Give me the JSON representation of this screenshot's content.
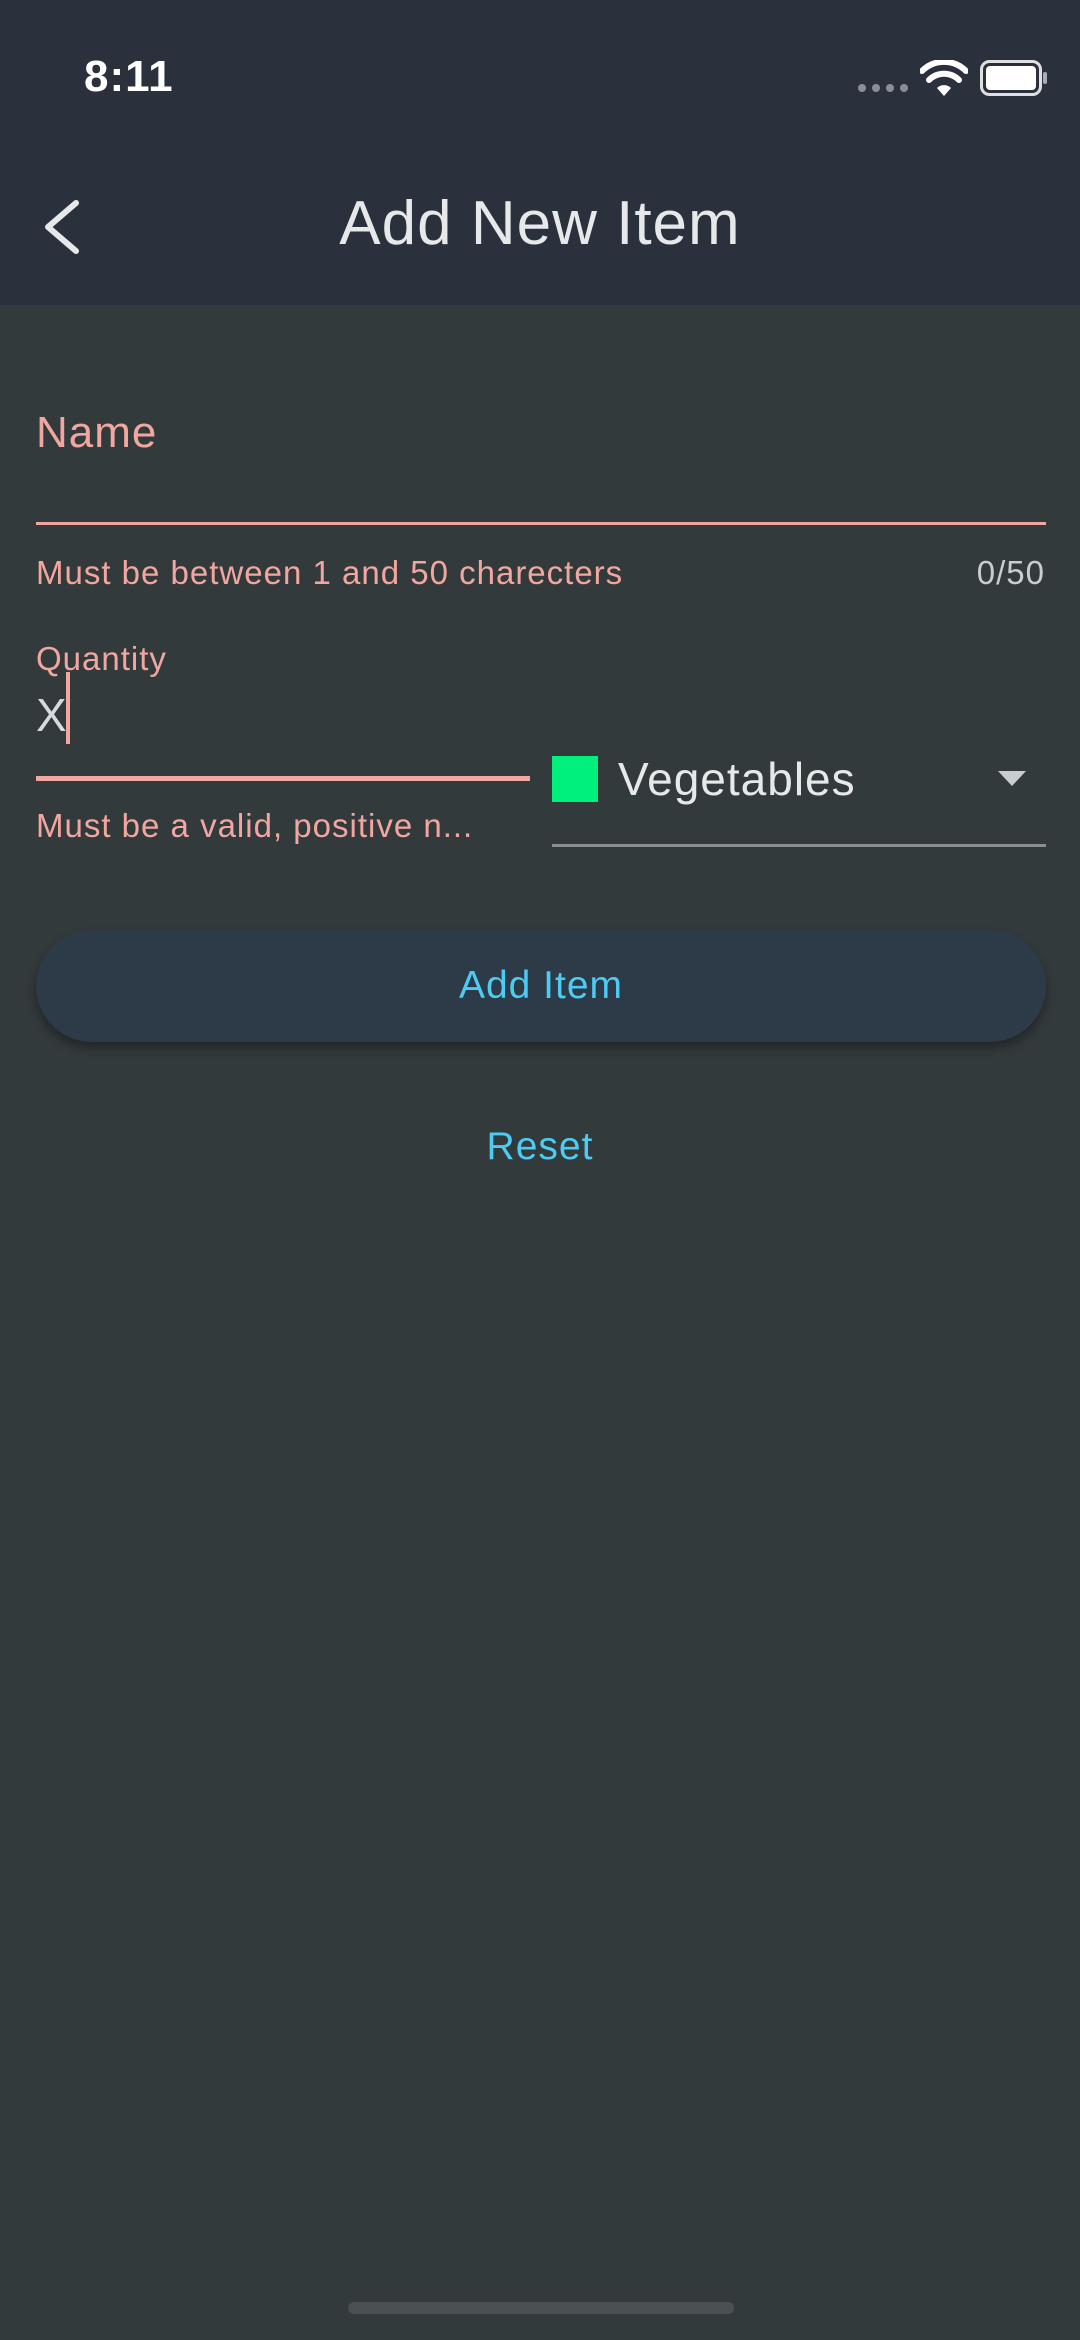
{
  "status_bar": {
    "time": "8:11"
  },
  "header": {
    "title": "Add New Item",
    "back_icon": "chevron-left-icon"
  },
  "form": {
    "name": {
      "label": "Name",
      "value": "",
      "error": "Must be between 1 and 50 charecters",
      "counter": "0/50"
    },
    "quantity": {
      "label": "Quantity",
      "value": "X",
      "error": "Must be a valid, positive n..."
    },
    "category": {
      "selected": "Vegetables",
      "swatch_color": "#00f07e"
    },
    "add_label": "Add Item",
    "reset_label": "Reset"
  },
  "colors": {
    "error": "#f1a7a0",
    "accent": "#4dcbf2",
    "background": "#333a3c",
    "app_bar": "#2b313c"
  }
}
